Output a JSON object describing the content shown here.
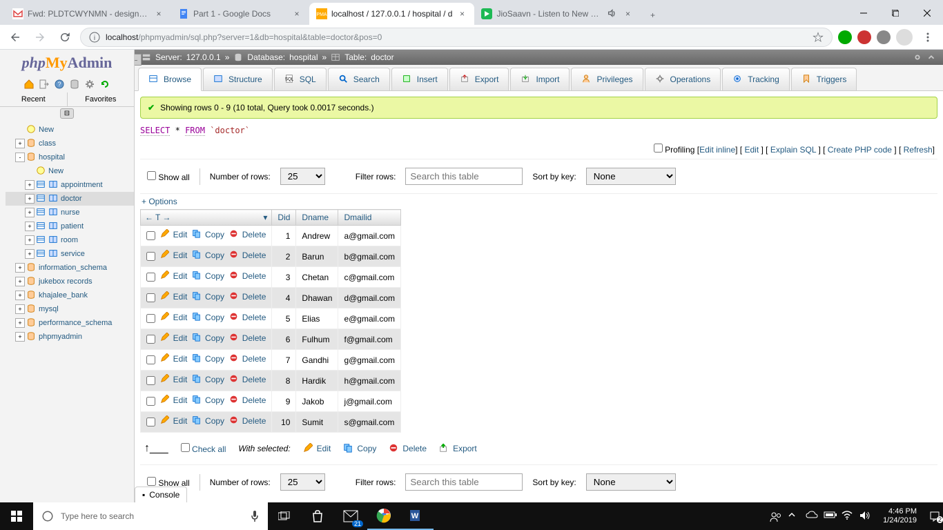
{
  "browser": {
    "tabs": [
      {
        "title": "Fwd: PLDTCWYNMN - design dat",
        "favicon": "gmail"
      },
      {
        "title": "Part 1 - Google Docs",
        "favicon": "docs"
      },
      {
        "title": "localhost / 127.0.0.1 / hospital / d",
        "favicon": "pma",
        "active": true
      },
      {
        "title": "JioSaavn - Listen to New & C",
        "favicon": "saavn",
        "audio": true
      }
    ],
    "url_host": "localhost",
    "url_path": "/phpmyadmin/sql.php?server=1&db=hospital&table=doctor&pos=0"
  },
  "sidebar": {
    "recent": "Recent",
    "favorites": "Favorites",
    "items": [
      {
        "label": "New",
        "icon": "new",
        "level": 1
      },
      {
        "label": "class",
        "icon": "db",
        "level": 1,
        "expand": "+"
      },
      {
        "label": "hospital",
        "icon": "db",
        "level": 1,
        "expand": "-"
      },
      {
        "label": "New",
        "icon": "new",
        "level": 2
      },
      {
        "label": "appointment",
        "icon": "table",
        "level": 2,
        "expand": "+"
      },
      {
        "label": "doctor",
        "icon": "table",
        "level": 2,
        "expand": "+",
        "selected": true
      },
      {
        "label": "nurse",
        "icon": "table",
        "level": 2,
        "expand": "+"
      },
      {
        "label": "patient",
        "icon": "table",
        "level": 2,
        "expand": "+"
      },
      {
        "label": "room",
        "icon": "table",
        "level": 2,
        "expand": "+"
      },
      {
        "label": "service",
        "icon": "table",
        "level": 2,
        "expand": "+"
      },
      {
        "label": "information_schema",
        "icon": "db",
        "level": 1,
        "expand": "+"
      },
      {
        "label": "jukebox records",
        "icon": "db",
        "level": 1,
        "expand": "+"
      },
      {
        "label": "khajalee_bank",
        "icon": "db",
        "level": 1,
        "expand": "+"
      },
      {
        "label": "mysql",
        "icon": "db",
        "level": 1,
        "expand": "+"
      },
      {
        "label": "performance_schema",
        "icon": "db",
        "level": 1,
        "expand": "+"
      },
      {
        "label": "phpmyadmin",
        "icon": "db",
        "level": 1,
        "expand": "+"
      }
    ]
  },
  "breadcrumb": {
    "server_label": "Server:",
    "server": "127.0.0.1",
    "db_label": "Database:",
    "db": "hospital",
    "table_label": "Table:",
    "table": "doctor"
  },
  "tabs": [
    "Browse",
    "Structure",
    "SQL",
    "Search",
    "Insert",
    "Export",
    "Import",
    "Privileges",
    "Operations",
    "Tracking",
    "Triggers"
  ],
  "success_msg": "Showing rows 0 - 9 (10 total, Query took 0.0017 seconds.)",
  "sql": {
    "select": "SELECT",
    "star": "*",
    "from": "FROM",
    "table": "`doctor`"
  },
  "action_row": {
    "profiling": "Profiling",
    "edit_inline": "Edit inline",
    "edit": "Edit",
    "explain": "Explain SQL",
    "create_php": "Create PHP code",
    "refresh": "Refresh"
  },
  "filter": {
    "show_all": "Show all",
    "num_rows_label": "Number of rows:",
    "num_rows_value": "25",
    "filter_label": "Filter rows:",
    "search_placeholder": "Search this table",
    "sort_label": "Sort by key:",
    "sort_value": "None"
  },
  "options": "+ Options",
  "columns": [
    "Did",
    "Dname",
    "Dmailid"
  ],
  "row_actions": {
    "edit": "Edit",
    "copy": "Copy",
    "delete": "Delete"
  },
  "rows": [
    {
      "did": "1",
      "dname": "Andrew",
      "dmailid": "a@gmail.com"
    },
    {
      "did": "2",
      "dname": "Barun",
      "dmailid": "b@gmail.com"
    },
    {
      "did": "3",
      "dname": "Chetan",
      "dmailid": "c@gmail.com"
    },
    {
      "did": "4",
      "dname": "Dhawan",
      "dmailid": "d@gmail.com"
    },
    {
      "did": "5",
      "dname": "Elias",
      "dmailid": "e@gmail.com"
    },
    {
      "did": "6",
      "dname": "Fulhum",
      "dmailid": "f@gmail.com"
    },
    {
      "did": "7",
      "dname": "Gandhi",
      "dmailid": "g@gmail.com"
    },
    {
      "did": "8",
      "dname": "Hardik",
      "dmailid": "h@gmail.com"
    },
    {
      "did": "9",
      "dname": "Jakob",
      "dmailid": "j@gmail.com"
    },
    {
      "did": "10",
      "dname": "Sumit",
      "dmailid": "s@gmail.com"
    }
  ],
  "bulk": {
    "check_all": "Check all",
    "with_selected": "With selected:",
    "edit": "Edit",
    "copy": "Copy",
    "delete": "Delete",
    "export": "Export"
  },
  "console": "Console",
  "taskbar": {
    "search_placeholder": "Type here to search",
    "time": "4:46 PM",
    "date": "1/24/2019"
  }
}
